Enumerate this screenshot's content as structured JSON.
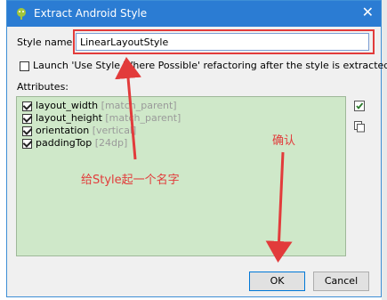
{
  "window": {
    "title": "Extract Android Style",
    "close_glyph": "✕",
    "app_icon": "android-studio-icon"
  },
  "form": {
    "style_name_label": "Style name:",
    "style_name_value": "LinearLayoutStyle",
    "launch_refactor_label": "Launch 'Use Style Where Possible' refactoring after the style is extracted",
    "launch_refactor_checked": false,
    "attributes_label": "Attributes:"
  },
  "attributes": [
    {
      "name": "layout_width",
      "value": "[match_parent]",
      "checked": true
    },
    {
      "name": "layout_height",
      "value": "[match_parent]",
      "checked": true
    },
    {
      "name": "orientation",
      "value": "[vertical]",
      "checked": true
    },
    {
      "name": "paddingTop",
      "value": "[24dp]",
      "checked": true
    }
  ],
  "side_tools": [
    "check-all-icon",
    "copy-icon"
  ],
  "annotations": {
    "name_hint": "给Style起一个名字",
    "confirm_hint": "确认"
  },
  "buttons": {
    "ok": "OK",
    "cancel": "Cancel"
  },
  "colors": {
    "title_bar": "#2b7cd3",
    "attributes_bg": "#cfe8c9",
    "annotation_red": "#e23b3b"
  }
}
